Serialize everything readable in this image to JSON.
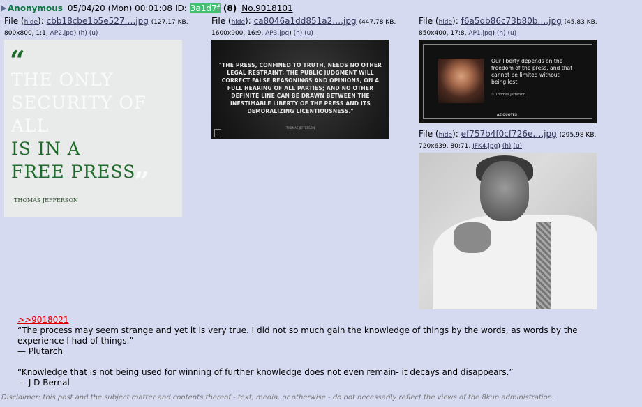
{
  "post": {
    "name": "Anonymous",
    "date": "05/04/20 (Mon) 00:01:08",
    "id_label": "ID:",
    "id": "3a1d7f",
    "id_count": "(8)",
    "number": "No.9018101"
  },
  "files": [
    {
      "label": "File (",
      "hide": "hide",
      "after_hide": "):",
      "name": "cbb18cbe1b5e527….jpg",
      "size": "(127.17 KB,",
      "meta": "800x800, 1:1,",
      "orig": "AP2.jpg",
      "h": "(h)",
      "u": "(u)"
    },
    {
      "label": "File (",
      "hide": "hide",
      "after_hide": "):",
      "name": "ca8046a1dd851a2….jpg",
      "size": "(447.78 KB,",
      "meta": "1600x900, 16:9,",
      "orig": "AP3.jpg",
      "h": "(h)",
      "u": "(u)"
    },
    {
      "label": "File (",
      "hide": "hide",
      "after_hide": "):",
      "name": "f6a5db86c73b80b….jpg",
      "size": "(45.83 KB,",
      "meta": "850x400, 17:8,",
      "orig": "AP1.jpg",
      "h": "(h)",
      "u": "(u)"
    },
    {
      "label": "File (",
      "hide": "hide",
      "after_hide": "):",
      "name": "ef757b4f0cf726e….jpg",
      "size": "(295.98 KB,",
      "meta": "720x639, 80:71,",
      "orig": "JFK4.jpg",
      "h": "(h)",
      "u": "(u)"
    }
  ],
  "thumb1": {
    "open_quote": "“",
    "line1": "THE ONLY",
    "line2": "SECURITY OF",
    "line3": "ALL",
    "line4": "IS IN A",
    "line5": "FREE PRESS",
    "close_quote": "”",
    "author": "THOMAS JEFFERSON"
  },
  "thumb2": {
    "quote": "\"THE PRESS, CONFINED TO TRUTH, NEEDS NO OTHER LEGAL RESTRAINT; THE PUBLIC JUDGMENT WILL CORRECT FALSE REASONINGS AND OPINIONS, ON A FULL HEARING OF ALL PARTIES; AND NO OTHER DEFINITE LINE CAN BE DRAWN BETWEEN THE INESTIMABLE LIBERTY OF THE PRESS AND ITS DEMORALIZING LICENTIOUSNESS.\"",
    "author": "THOMAS JEFFERSON"
  },
  "thumb3": {
    "quote": "Our liberty depends on the freedom of the press, and that cannot be limited without being lost.",
    "author": "~ Thomas Jefferson",
    "brand": "AZ QUOTES"
  },
  "body": {
    "reply_link": ">>9018021",
    "quote1": "“The process may seem strange and yet it is very true. I did not so much gain the knowledge of things by the words, as words by the experience I had of things.”",
    "author1": "— Plutarch",
    "quote2": "“Knowledge that is not being used for winning of further knowledge does not even remain- it decays and disappears.”",
    "author2": "— J D Bernal"
  },
  "disclaimer": "Disclaimer: this post and the subject matter and contents thereof - text, media, or otherwise - do not necessarily reflect the views of the 8kun administration.",
  "colors": {
    "background": "#d6daf0",
    "name": "#117743",
    "id_highlight": "#40c070",
    "link": "#34345c",
    "reply_link": "#dd0000"
  }
}
